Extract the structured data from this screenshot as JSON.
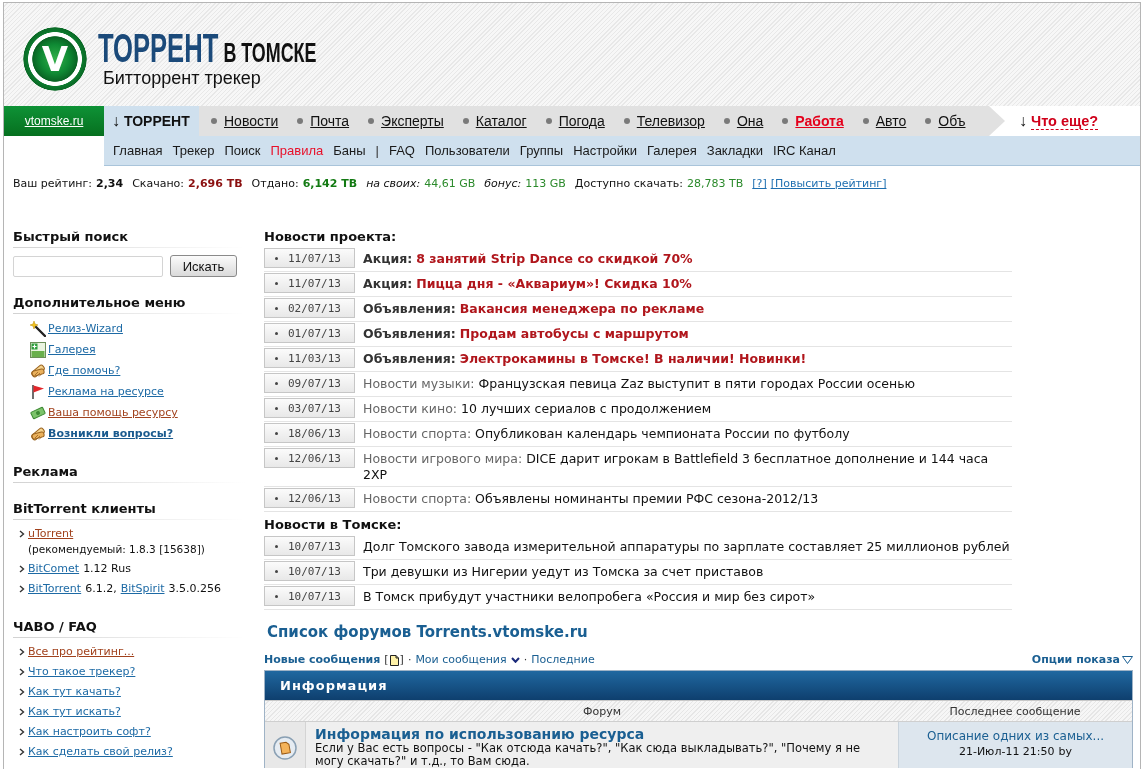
{
  "header": {
    "logo_letter": "V",
    "title": "ТОРРЕНТ",
    "title_city": "В ТОМСКЕ",
    "subtitle": "Битторрент трекер"
  },
  "main_nav": {
    "site_link": "vtomske.ru",
    "current": {
      "arrow": "↓",
      "label": "ТОРРЕНТ"
    },
    "items": [
      {
        "label": "Новости",
        "highlighted": false
      },
      {
        "label": "Почта",
        "highlighted": false
      },
      {
        "label": "Эксперты",
        "highlighted": false
      },
      {
        "label": "Каталог",
        "highlighted": false
      },
      {
        "label": "Погода",
        "highlighted": false
      },
      {
        "label": "Телевизор",
        "highlighted": false
      },
      {
        "label": "Она",
        "highlighted": false
      },
      {
        "label": "Работа",
        "highlighted": true
      },
      {
        "label": "Авто",
        "highlighted": false
      },
      {
        "label": "Объ",
        "highlighted": false
      }
    ],
    "more": {
      "arrow": "↓",
      "label": "Что еще?"
    }
  },
  "sub_nav": [
    {
      "kind": "link",
      "label": "Главная",
      "highlighted": false
    },
    {
      "kind": "link",
      "label": "Трекер",
      "highlighted": false
    },
    {
      "kind": "link",
      "label": "Поиск",
      "highlighted": false
    },
    {
      "kind": "link",
      "label": "Правила",
      "highlighted": true
    },
    {
      "kind": "link",
      "label": "Баны",
      "highlighted": false
    },
    {
      "kind": "separator",
      "label": "|"
    },
    {
      "kind": "link",
      "label": "FAQ",
      "highlighted": false
    },
    {
      "kind": "link",
      "label": "Пользователи",
      "highlighted": false
    },
    {
      "kind": "link",
      "label": "Группы",
      "highlighted": false
    },
    {
      "kind": "link",
      "label": "Настройки",
      "highlighted": false
    },
    {
      "kind": "link",
      "label": "Галерея",
      "highlighted": false
    },
    {
      "kind": "link",
      "label": "Закладки",
      "highlighted": false
    },
    {
      "kind": "link",
      "label": "IRC Канал",
      "highlighted": false
    }
  ],
  "stats": {
    "items": [
      {
        "kind": "rating",
        "label": "Ваш рейтинг:",
        "value": "2,34"
      },
      {
        "kind": "downloaded",
        "label": "Скачано:",
        "value": "2,696 TB"
      },
      {
        "kind": "uploaded",
        "label": "Отдано:",
        "value": "6,142 TB"
      },
      {
        "kind": "own",
        "label": "на своих:",
        "value": "44,61 GB"
      },
      {
        "kind": "bonus",
        "label": "бонус:",
        "value": "113 GB"
      },
      {
        "kind": "available",
        "label": "Доступно скачать:",
        "value": "28,783 TB"
      }
    ],
    "links": [
      "[?]",
      "[Повысить рейтинг]"
    ]
  },
  "sidebar": {
    "search": {
      "title": "Быстрый поиск",
      "button": "Искать"
    },
    "menu": {
      "title": "Дополнительное меню",
      "items": [
        {
          "kind": "wizard",
          "label": "Релиз-Wizard",
          "visited": false,
          "bold": false
        },
        {
          "kind": "gallery",
          "label": "Галерея",
          "visited": false,
          "bold": false
        },
        {
          "kind": "help",
          "label": "Где помочь?",
          "visited": false,
          "bold": false
        },
        {
          "kind": "ads",
          "label": "Реклама на ресурсе",
          "visited": false,
          "bold": false
        },
        {
          "kind": "donate",
          "label": "Ваша помощь ресурсу",
          "visited": true,
          "bold": false
        },
        {
          "kind": "questions",
          "label": "Возникли вопросы?",
          "visited": false,
          "bold": true
        }
      ]
    },
    "ads": {
      "title": "Реклама"
    },
    "clients": {
      "title": "BitTorrent клиенты",
      "items": [
        {
          "segments": [
            {
              "kind": "link",
              "text": "uTorrent",
              "visited": true
            }
          ],
          "note": "(рекомендуемый: 1.8.3 [15638])"
        },
        {
          "segments": [
            {
              "kind": "link",
              "text": "BitComet",
              "visited": false
            },
            {
              "kind": "text",
              "text": "1.12 Rus"
            }
          ]
        },
        {
          "segments": [
            {
              "kind": "link",
              "text": "BitTorrent",
              "visited": false
            },
            {
              "kind": "text",
              "text": "6.1.2,"
            },
            {
              "kind": "link",
              "text": "BitSpirit",
              "visited": false
            },
            {
              "kind": "text",
              "text": "3.5.0.256"
            }
          ]
        }
      ]
    },
    "faq": {
      "title": "ЧАВО / FAQ",
      "items": [
        {
          "label": "Все про рейтинг...",
          "visited": true
        },
        {
          "label": "Что такое трекер?",
          "visited": false
        },
        {
          "label": "Как тут качать?",
          "visited": false
        },
        {
          "label": "Как тут искать?",
          "visited": false
        },
        {
          "label": "Как настроить софт?",
          "visited": false
        },
        {
          "label": "Как сделать свой релиз?",
          "visited": false
        }
      ]
    }
  },
  "news": [
    {
      "title": "Новости проекта:",
      "items": [
        {
          "kind": "announcement",
          "date": "11/07/13",
          "category": "Акция:",
          "headline": "8 занятий Strip Dance со скидкой 70%"
        },
        {
          "kind": "announcement",
          "date": "11/07/13",
          "category": "Акция:",
          "headline": "Пицца дня - «Аквариум»! Скидка 10%"
        },
        {
          "kind": "announcement",
          "date": "02/07/13",
          "category": "Объявления:",
          "headline": "Вакансия менеджера по рекламе"
        },
        {
          "kind": "announcement",
          "date": "01/07/13",
          "category": "Объявления:",
          "headline": "Продам автобусы с маршрутом"
        },
        {
          "kind": "announcement",
          "date": "11/03/13",
          "category": "Объявления:",
          "headline": "Электрокамины в Томске! В наличии! Новинки!"
        },
        {
          "kind": "news",
          "date": "09/07/13",
          "category": "Новости музыки:",
          "headline": "Французская певица Zaz выступит в пяти городах России осенью"
        },
        {
          "kind": "news",
          "date": "03/07/13",
          "category": "Новости кино:",
          "headline": "10 лучших сериалов с продолжением"
        },
        {
          "kind": "news",
          "date": "18/06/13",
          "category": "Новости спорта:",
          "headline": "Опубликован календарь чемпионата России по футболу"
        },
        {
          "kind": "news",
          "date": "12/06/13",
          "category": "Новости игрового мира:",
          "headline": "DICE дарит игрокам в Battlefield 3 бесплатное дополнение и 144 часа 2XP"
        },
        {
          "kind": "news",
          "date": "12/06/13",
          "category": "Новости спорта:",
          "headline": "Объявлены номинанты премии РФС сезона-2012/13"
        }
      ]
    },
    {
      "title": "Новости в Томске:",
      "items": [
        {
          "kind": "local",
          "date": "10/07/13",
          "headline": "Долг Томского завода измерительной аппаратуры по зарплате составляет 25 миллионов рублей"
        },
        {
          "kind": "local",
          "date": "10/07/13",
          "headline": "Три девушки из Нигерии уедут из Томска за счет приставов"
        },
        {
          "kind": "local",
          "date": "10/07/13",
          "headline": "В Томск прибудут участники велопробега «Россия и мир без сирот»"
        }
      ]
    }
  ],
  "forum": {
    "title": "Список форумов Torrents.vtomske.ru",
    "quick_links": [
      {
        "kind": "new",
        "label": "Новые сообщения",
        "bold": true,
        "icon_open": "[",
        "icon_close": "]"
      },
      {
        "kind": "mine",
        "separator": "·",
        "label": "Мои сообщения",
        "bold": false
      },
      {
        "kind": "latest",
        "separator": "·",
        "label": "Последние",
        "bold": false
      }
    ],
    "display_options": "Опции показа",
    "category": "Информация",
    "columns": [
      "Форум",
      "Последнее сообщение"
    ],
    "rows": [
      {
        "name": "Информация по использованию ресурса",
        "description": "Если у Вас есть вопросы - \"Как отсюда качать?\", \"Как сюда выкладывать?\", \"Почему я не могу скачать?\" и т.д., то Вам сюда.",
        "last_post": {
          "title": "Описание одних из самых...",
          "time": "21-Июл-11 21:50",
          "by": "by"
        }
      }
    ]
  }
}
